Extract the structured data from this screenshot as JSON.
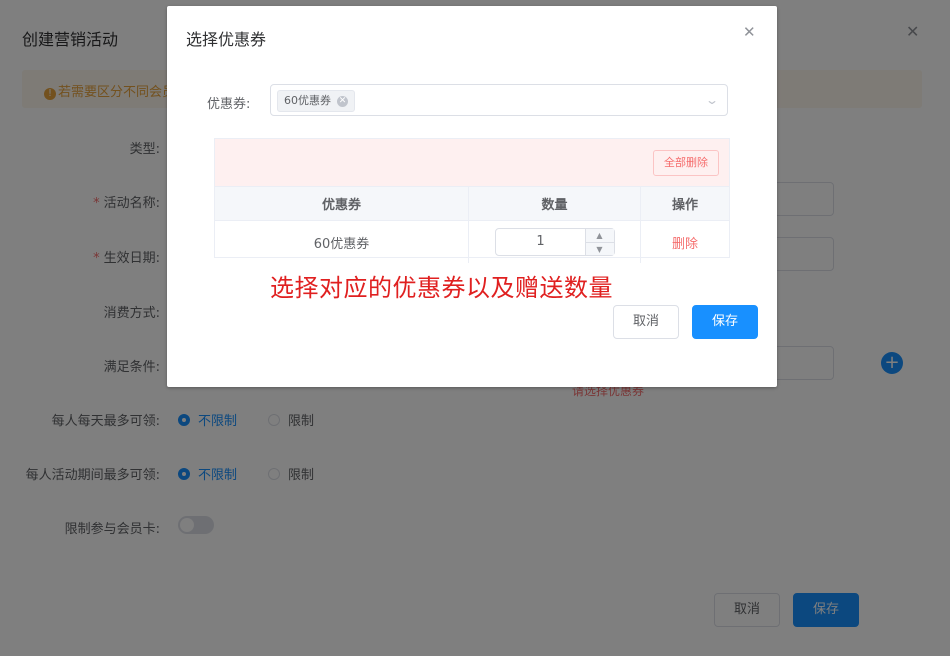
{
  "background_form": {
    "title": "创建营销活动",
    "notice": "若需要区分不同会员",
    "labels": {
      "type": "类型:",
      "name": "活动名称:",
      "date": "生效日期:",
      "consume": "消费方式:",
      "condition": "满足条件:",
      "daily_limit": "每人每天最多可领:",
      "period_limit": "每人活动期间最多可领:",
      "member_card": "限制参与会员卡:"
    },
    "radio_unlimited": "不限制",
    "radio_limited": "限制",
    "coupon_hint": "请选择优惠券",
    "cancel": "取消",
    "save": "保存",
    "colors": {
      "primary": "#1890ff",
      "danger": "#f56c6c",
      "warning": "#e6a23c"
    }
  },
  "dialog": {
    "title": "选择优惠券",
    "coupon_label": "优惠券:",
    "selected_tag": "60优惠券",
    "delete_all": "全部删除",
    "table": {
      "headers": [
        "优惠券",
        "数量",
        "操作"
      ],
      "rows": [
        {
          "coupon": "60优惠券",
          "quantity": "1",
          "action": "删除"
        }
      ]
    },
    "annotation": "选择对应的优惠券以及赠送数量",
    "cancel": "取消",
    "save": "保存"
  }
}
